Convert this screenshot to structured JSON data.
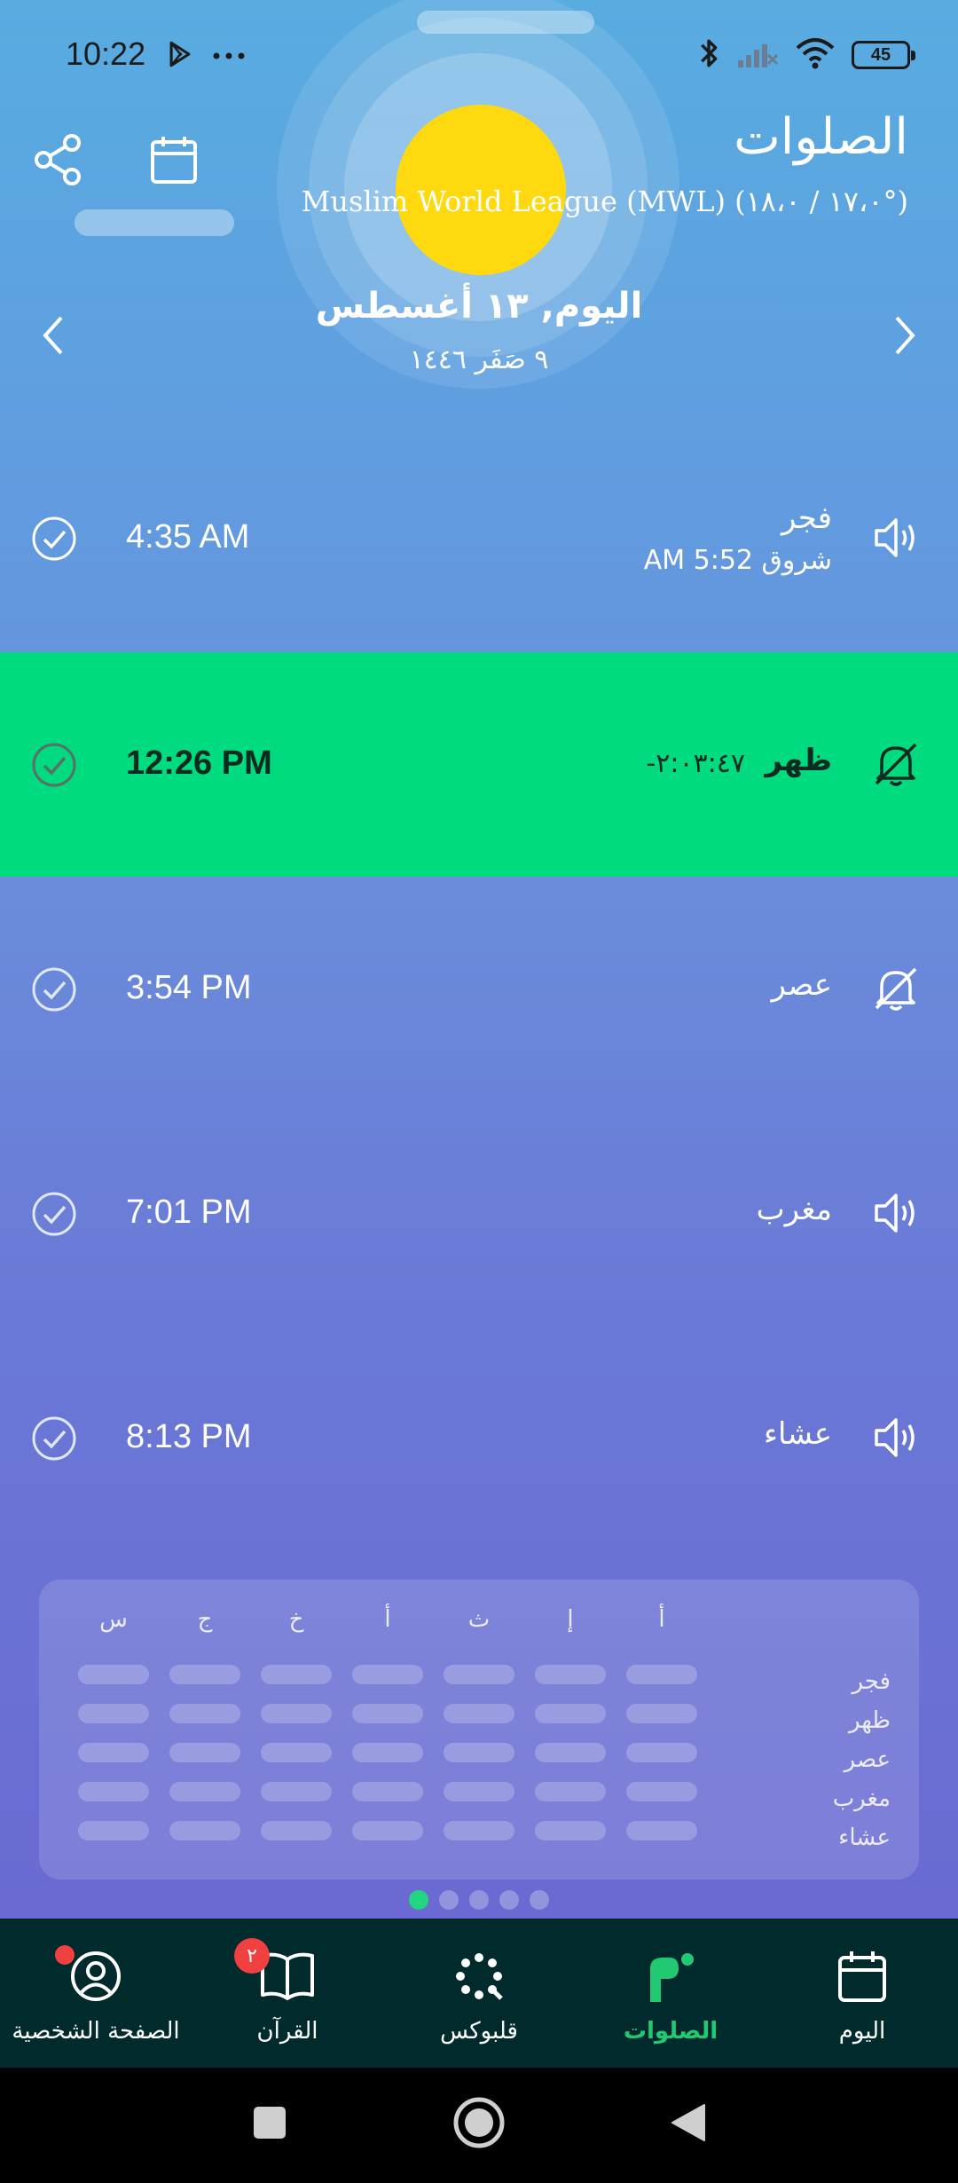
{
  "status_bar": {
    "time": "10:22",
    "battery": "45",
    "left_icons": [
      "play-store-icon",
      "more-dots-icon"
    ],
    "right_icons": [
      "bluetooth-icon",
      "signal-off-icon",
      "wifi-icon",
      "battery-icon"
    ]
  },
  "header": {
    "title": "الصلوات",
    "method": "Muslim World League (MWL) (١٧،٠ / ١٨،٠°)",
    "share_icon": "share-icon",
    "calendar_icon": "calendar-icon"
  },
  "date": {
    "gregorian": "اليوم, ١٣ أغسطس",
    "hijri": "٩ صَفَر ١٤٤٦"
  },
  "prayers": [
    {
      "name": "فجر",
      "time": "4:35 AM",
      "sub": "شروق AM 5:52",
      "bell": "speaker-icon",
      "active": false
    },
    {
      "name": "ظهر",
      "time": "12:26 PM",
      "countdown": "-٢:٠٣:٤٧",
      "bell": "bell-off-icon",
      "active": true
    },
    {
      "name": "عصر",
      "time": "3:54 PM",
      "bell": "bell-off-icon",
      "active": false
    },
    {
      "name": "مغرب",
      "time": "7:01 PM",
      "bell": "speaker-icon",
      "active": false
    },
    {
      "name": "عشاء",
      "time": "8:13 PM",
      "bell": "speaker-icon",
      "active": false
    }
  ],
  "week_card": {
    "days": [
      "س",
      "ج",
      "خ",
      "أ",
      "ث",
      "إ",
      "أ"
    ],
    "rows": [
      "فجر",
      "ظهر",
      "عصر",
      "مغرب",
      "عشاء"
    ]
  },
  "pager": {
    "count": 5,
    "current": 1
  },
  "bottom_nav": {
    "items": [
      {
        "label": "الصفحة الشخصية",
        "icon": "profile-icon",
        "badge_dot": true
      },
      {
        "label": "القرآن",
        "icon": "quran-book-icon",
        "badge": "٢"
      },
      {
        "label": "قلبوكس",
        "icon": "qalboox-icon"
      },
      {
        "label": "الصلوات",
        "icon": "prayers-icon",
        "active": true
      },
      {
        "label": "اليوم",
        "icon": "today-calendar-icon"
      }
    ]
  },
  "colors": {
    "active_row": "#00db7f",
    "nav_bg": "#012a2c",
    "accent": "#22c973",
    "sun": "#ffd90f"
  }
}
